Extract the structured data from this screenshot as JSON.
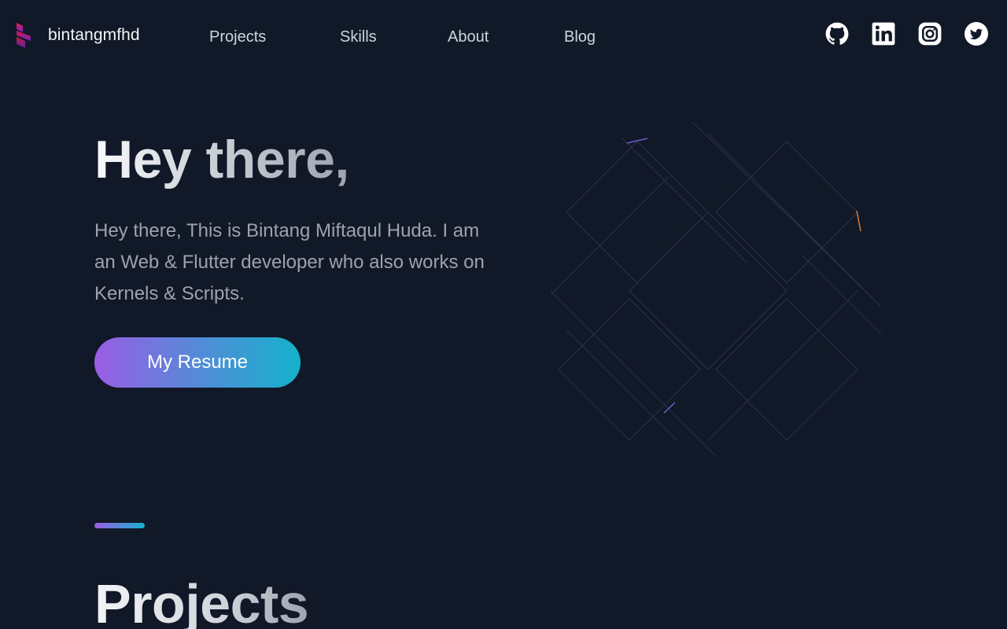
{
  "nav": {
    "brand": "bintangmfhd",
    "links": [
      "Projects",
      "Skills",
      "About",
      "Blog"
    ],
    "social": [
      "github-icon",
      "linkedin-icon",
      "instagram-icon",
      "twitter-icon"
    ]
  },
  "hero": {
    "title": "Hey there,",
    "description": "Hey there, This is Bintang Miftaqul Huda. I am an Web & Flutter developer who also works on Kernels & Scripts.",
    "button": "My Resume"
  },
  "section": {
    "title": "Projects"
  },
  "colors": {
    "background": "#111827",
    "accent_start": "#9b5de5",
    "accent_end": "#14b2cc",
    "logo_top": "#e11d48",
    "logo_bottom": "#7e22ce"
  }
}
